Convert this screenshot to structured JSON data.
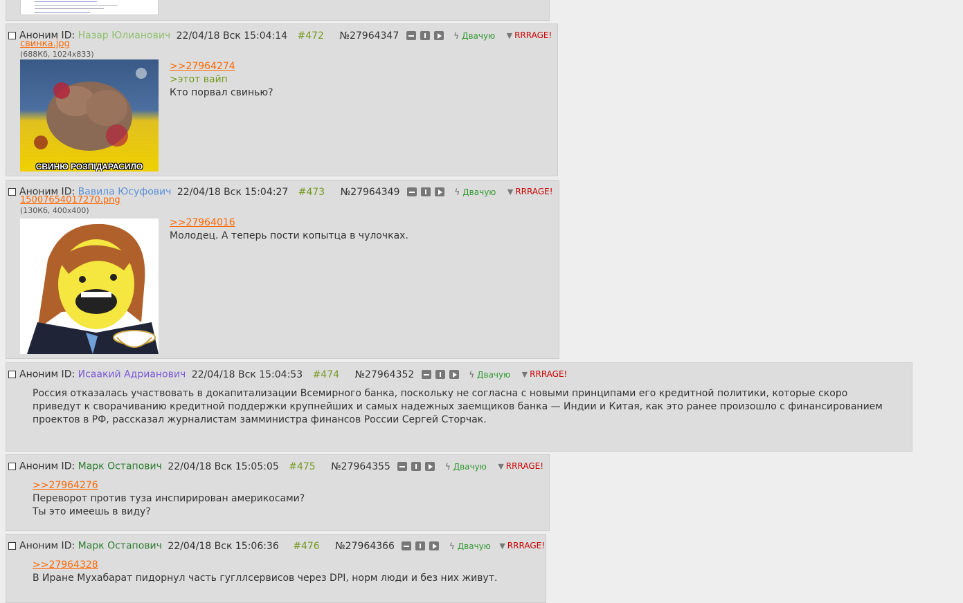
{
  "colors": {
    "post_bg": "#dddddd",
    "reply_link": "#ff6600",
    "post_number": "#789922",
    "like": "#339933",
    "dislike": "#cc0000"
  },
  "posts": [
    {
      "anon": "Аноним ID:",
      "id_name": "Назар Юлианович",
      "id_color": "#8fbf6f",
      "date": "22/04/18 Вск 15:04:14",
      "num": "#472",
      "no": "№27964347",
      "like": "Двачую",
      "dislike": "RRRAGE!",
      "file_name": "свинка.jpg",
      "file_info": "(688Кб, 1024x833)",
      "image_caption": "СВИНЮ РОЗПІДАРАСИЛО",
      "lines": [
        ">>27964274",
        ">этот вайп",
        "Кто порвал свинью?"
      ]
    },
    {
      "anon": "Аноним ID:",
      "id_name": "Вавила Юсуфович",
      "id_color": "#5a8fd6",
      "date": "22/04/18 Вск 15:04:27",
      "num": "#473",
      "no": "№27964349",
      "like": "Двачую",
      "dislike": "RRRAGE!",
      "file_name": "15007654017270.png",
      "file_info": "(130Кб, 400x400)",
      "lines": [
        ">>27964016",
        "Молодец. А теперь пости копытца в чулочках."
      ]
    },
    {
      "anon": "Аноним ID:",
      "id_name": "Исаакий Адрианович",
      "id_color": "#7a5ad6",
      "date": "22/04/18 Вск 15:04:53",
      "num": "#474",
      "no": "№27964352",
      "like": "Двачую",
      "dislike": "RRRAGE!",
      "lines": [
        "Россия отказалась участвовать в докапитализации Всемирного банка, поскольку не согласна с новыми принципами его кредитной политики, которые скоро",
        "приведут к сворачиванию кредитной поддержки крупнейших и самых надежных заемщиков банка — Индии и Китая, как это ранее произошло с финансированием",
        "проектов в РФ, рассказал журналистам замминистра финансов России Сергей Сторчак."
      ]
    },
    {
      "anon": "Аноним ID:",
      "id_name": "Марк Остапович",
      "id_color": "#2e7d32",
      "date": "22/04/18 Вск 15:05:05",
      "num": "#475",
      "no": "№27964355",
      "like": "Двачую",
      "dislike": "RRRAGE!",
      "lines": [
        ">>27964276",
        "Переворот против туза инспирирован америкосами?",
        "Ты это имеешь в виду?"
      ]
    },
    {
      "anon": "Аноним ID:",
      "id_name": "Марк Остапович",
      "id_color": "#2e7d32",
      "date": "22/04/18 Вск 15:06:36",
      "num": "#476",
      "no": "№27964366",
      "like": "Двачую",
      "dislike": "RRRAGE!",
      "lines": [
        ">>27964328",
        "В Иране Мухабарат пидорнул часть гугллсервисов через DPI, норм люди и без них живут."
      ]
    }
  ]
}
